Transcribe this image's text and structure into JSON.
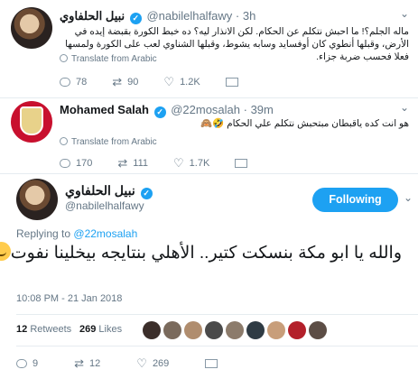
{
  "tweets": [
    {
      "name": "نبيل الحلفاوي",
      "handle": "@nabilelhalfawy",
      "time": "· 3h",
      "text": "ماله الجلم؟! ما احبش نتكلم عن الحكام. لكن الانذار ليه؟ ده خبط الكورة بقبضة إيده في الأرض، وقبلها أنطوي كان أوفسايد وسابه يشوط، وقبلها الشناوي لعب على الكورة ولمسها فعلا فحسب ضربة جزاء.",
      "translate": "Translate from Arabic",
      "replies": "78",
      "retweets": "90",
      "likes": "1.2K"
    },
    {
      "name": "Mohamed Salah",
      "handle": "@22mosalah",
      "time": "· 39m",
      "text": "هو انت كده ياقبطان مبتحبش نتكلم علي الحكام 🤣🙈",
      "translate": "Translate from Arabic",
      "replies": "170",
      "retweets": "111",
      "likes": "1.7K"
    }
  ],
  "main_tweet": {
    "name": "نبيل الحلفاوي",
    "handle": "@nabilelhalfawy",
    "follow_label": "Following",
    "replying_prefix": "Replying to",
    "replying_to": "@22mosalah",
    "text": "والله يا ابو مكة بنسكت كتير.. الأهلي بنتايجه بيخلينا نفوت",
    "timestamp": "10:08 PM - 21 Jan 2018",
    "retweets_count": "12",
    "retweets_label": "Retweets",
    "likes_count": "269",
    "likes_label": "Likes",
    "replies": "9",
    "retweets": "12",
    "likes": "269"
  },
  "icons": {
    "verified": "✓",
    "caret": "⌄",
    "retweet": "⇄",
    "like": "♡"
  },
  "colors": {
    "accent": "#1da1f2",
    "muted": "#657786"
  }
}
